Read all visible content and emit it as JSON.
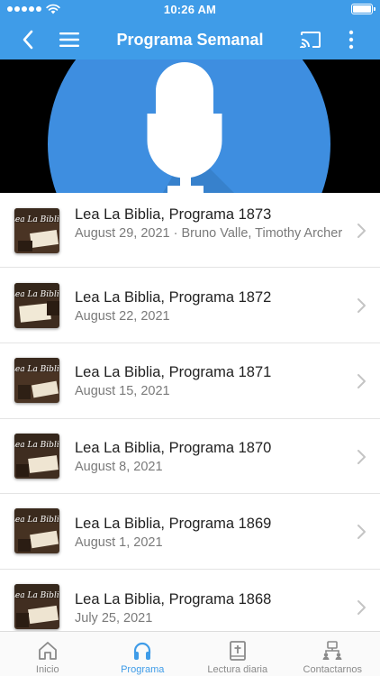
{
  "status_bar": {
    "time": "10:26 AM"
  },
  "nav": {
    "title": "Programa Semanal"
  },
  "colors": {
    "brand": "#3f9ce8",
    "active_tab": "#3f9ce8",
    "inactive_tab": "#8a8a8a"
  },
  "episodes": [
    {
      "title": "Lea La Biblia, Programa 1873",
      "subtitle": "August 29, 2021 · Bruno Valle, Timothy Archer"
    },
    {
      "title": "Lea La Biblia, Programa 1872",
      "subtitle": "August 22, 2021"
    },
    {
      "title": "Lea La Biblia, Programa 1871",
      "subtitle": "August 15, 2021"
    },
    {
      "title": "Lea La Biblia, Programa 1870",
      "subtitle": "August 8, 2021"
    },
    {
      "title": "Lea La Biblia, Programa 1869",
      "subtitle": "August 1, 2021"
    },
    {
      "title": "Lea La Biblia, Programa 1868",
      "subtitle": "July 25, 2021"
    }
  ],
  "thumbnail": {
    "brand_text": "Lea La Biblia"
  },
  "tabs": [
    {
      "label": "Inicio",
      "icon": "home-icon",
      "active": false
    },
    {
      "label": "Programa",
      "icon": "headphones-icon",
      "active": true
    },
    {
      "label": "Lectura diaria",
      "icon": "bible-icon",
      "active": false
    },
    {
      "label": "Contactarnos",
      "icon": "contact-icon",
      "active": false
    }
  ]
}
